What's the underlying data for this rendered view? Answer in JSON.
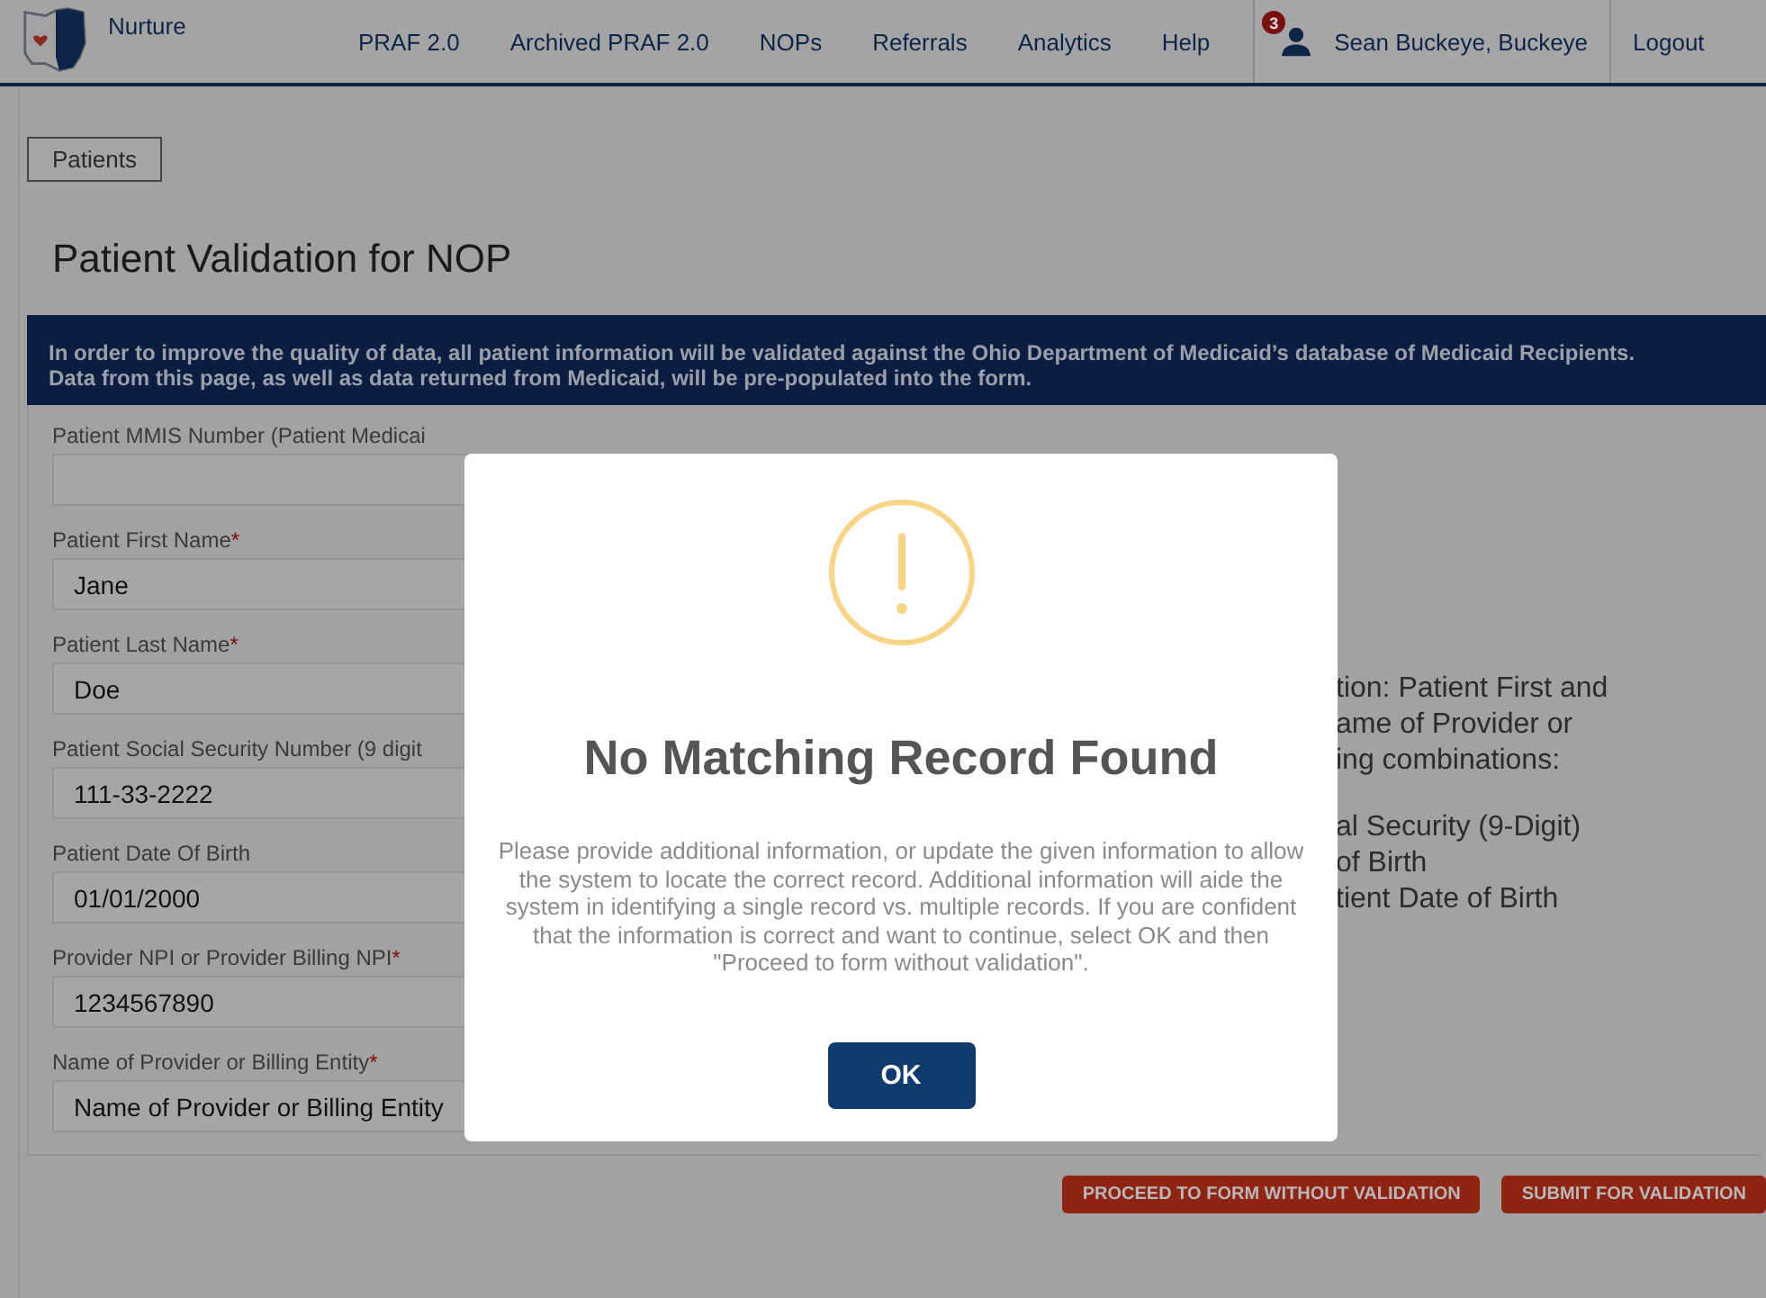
{
  "nav": {
    "brand": "Nurture",
    "links": [
      "PRAF 2.0",
      "Archived PRAF 2.0",
      "NOPs",
      "Referrals",
      "Analytics",
      "Help"
    ],
    "badge": "3",
    "user": "Sean Buckeye, Buckeye",
    "logout": "Logout"
  },
  "breadcrumb": "Patients",
  "title": "Patient Validation for NOP",
  "banner": "In order to improve the quality of data, all patient information will be validated against the Ohio Department of Medicaid’s database of Medicaid Recipients. Data from this page, as well as data returned from Medicaid, will be pre-populated into the form.",
  "fields": [
    {
      "label": "Patient MMIS Number (Patient Medicai"
    },
    {
      "label": "Patient First Name",
      "marker": "*",
      "value": "Jane"
    },
    {
      "label": "Patient Last Name",
      "marker": "*",
      "value": "Doe"
    },
    {
      "label": "Patient Social Security Number (9 digit",
      "value": "111-33-2222"
    },
    {
      "label": "Patient Date Of Birth",
      "value": "01/01/2000"
    },
    {
      "label": "Provider NPI or Provider Billing NPI",
      "marker": "*",
      "value": "1234567890"
    },
    {
      "label": "Name of Provider or Billing Entity",
      "marker": "*",
      "value": "Name of Provider or Billing Entity"
    }
  ],
  "info_blocks": [
    [
      "tion: Patient First and",
      "ame of Provider or",
      "ing combinations:"
    ],
    [
      "al Security (9-Digit)",
      "of Birth",
      "tient Date of Birth"
    ]
  ],
  "modal": {
    "title": "No Matching Record Found",
    "message": "Please provide additional information, or update the given information to allow the system to locate the correct record. Additional information will aide the system in identifying a single record vs. multiple records. If you are confident that the information is correct and want to continue, select OK and then \"Proceed to form without validation\".",
    "button": "OK"
  },
  "actions": [
    "PROCEED TO FORM WITHOUT VALIDATION",
    "SUBMIT FOR VALIDATION"
  ]
}
